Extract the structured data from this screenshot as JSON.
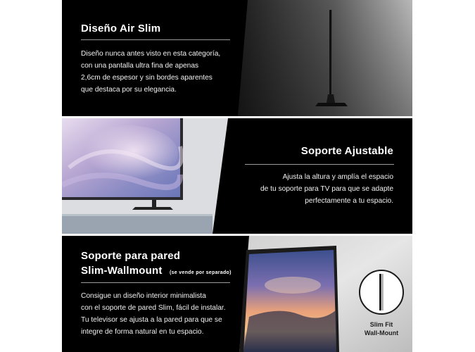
{
  "section_air_slim": {
    "title": "Diseño Air Slim",
    "lines": [
      "Diseño nunca antes visto en esta categoría,",
      "con una pantalla ultra fina de apenas",
      "2,6cm de espesor y sin bordes aparentes",
      "que destaca por su elegancia."
    ]
  },
  "section_stand": {
    "title": "Soporte Ajustable",
    "lines": [
      "Ajusta la altura y amplía el espacio",
      "de tu soporte para TV para que se adapte",
      "perfectamente a tu espacio."
    ]
  },
  "section_wall": {
    "title_line1": "Soporte para pared",
    "title_line2": "Slim-Wallmount",
    "note": "(se vende por separado)",
    "lines": [
      "Consigue un diseño interior minimalista",
      "con el soporte de pared Slim, fácil de instalar.",
      "Tu televisor se ajusta a la pared para que se",
      "integre de forma natural en tu espacio."
    ],
    "badge_line1": "Slim Fit",
    "badge_line2": "Wall-Mount"
  },
  "colors": {
    "panel_bg": "#000000",
    "text": "#ffffff",
    "rule": "#9a9a9a"
  }
}
